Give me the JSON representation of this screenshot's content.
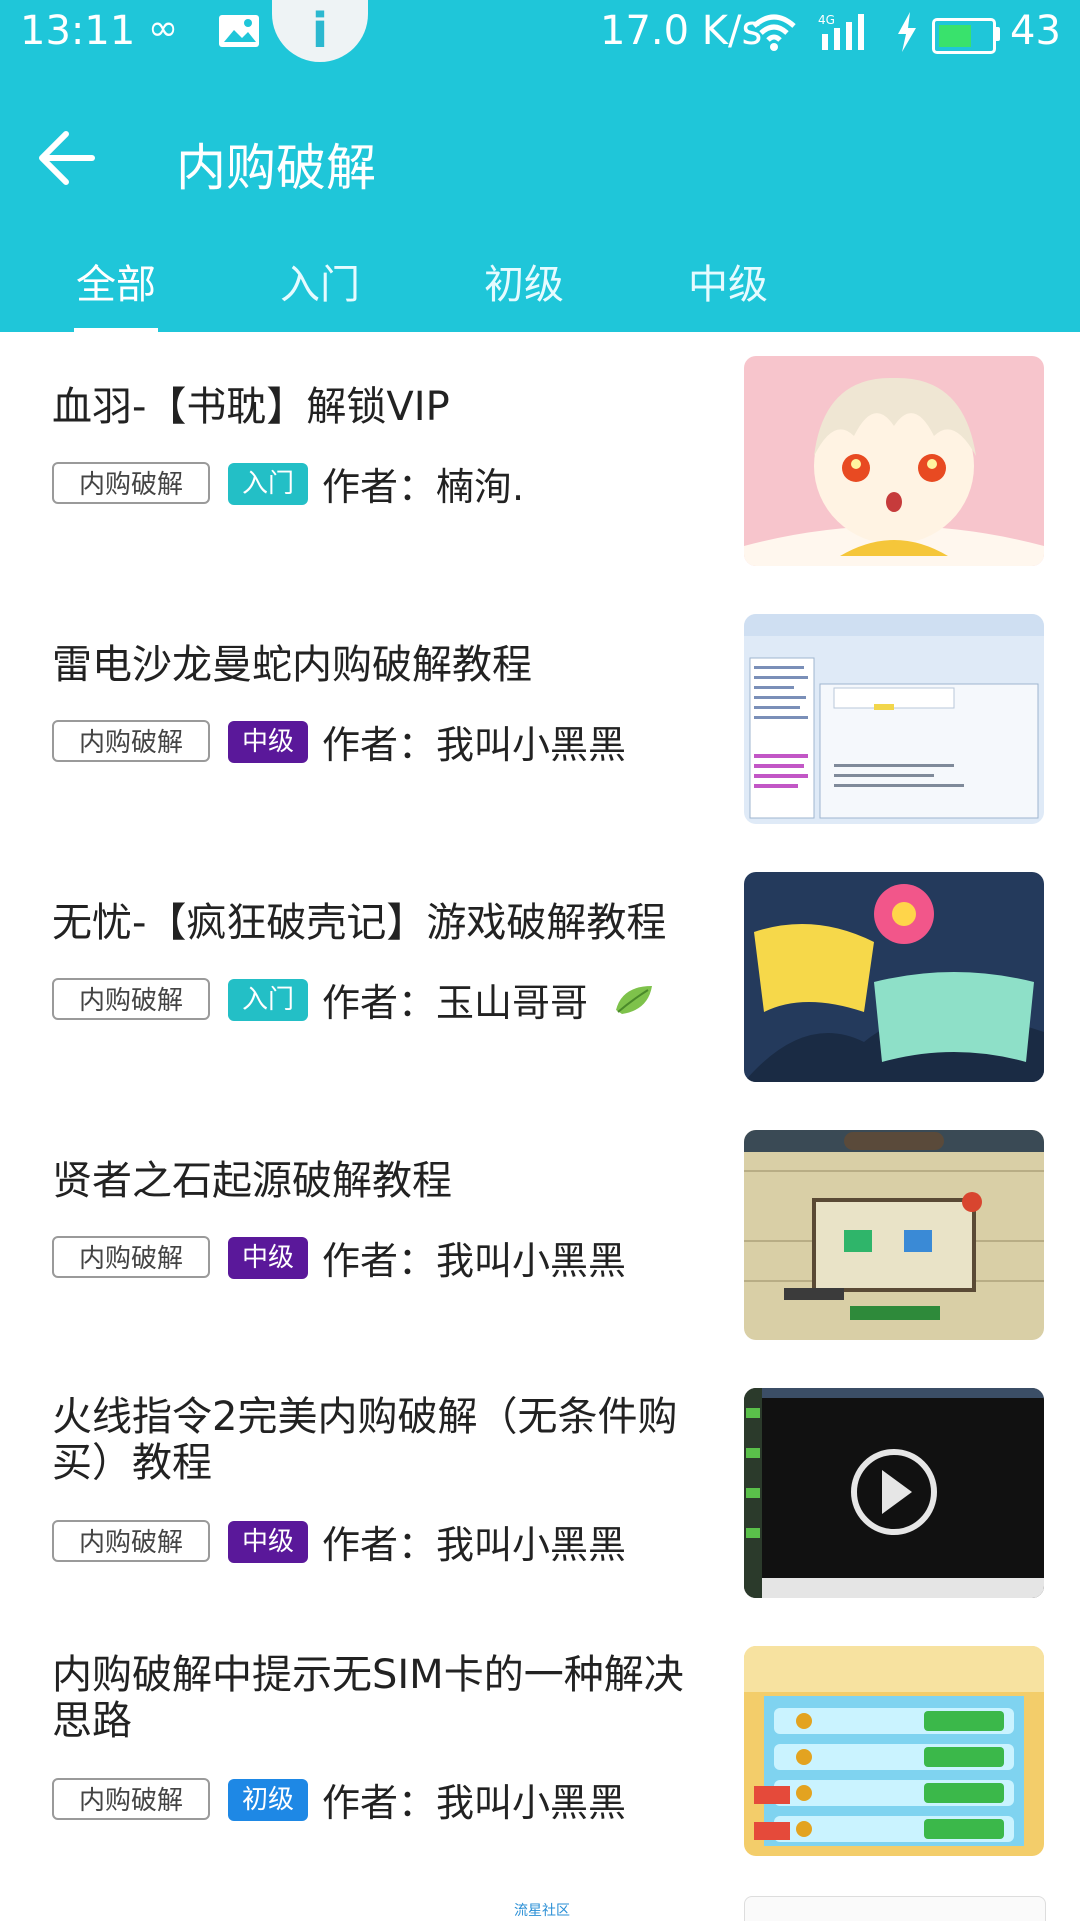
{
  "status_bar": {
    "time": "13:11",
    "speed": "17.0 K/s",
    "battery_level": "43",
    "battery_fraction": 0.43,
    "icons": [
      "infinity-icon",
      "image-icon",
      "info-icon",
      "wifi-icon",
      "signal-4g-icon",
      "charging-icon",
      "battery-icon"
    ]
  },
  "header": {
    "title": "内购破解",
    "back_icon": "arrow-left-icon",
    "background": "#1fc6d9"
  },
  "tabs": [
    {
      "label": "全部",
      "active": true
    },
    {
      "label": "入门",
      "active": false
    },
    {
      "label": "初级",
      "active": false
    },
    {
      "label": "中级",
      "active": false
    }
  ],
  "level_colors": {
    "入门": "#23bfc6",
    "中级": "#5a189a",
    "初级": "#1e88e5"
  },
  "items": [
    {
      "title": "血羽-【书耽】解锁VIP",
      "category": "内购破解",
      "level": "入门",
      "author": "作者：楠洵.",
      "thumb": "anime-character-thumbnail"
    },
    {
      "title": "雷电沙龙曼蛇内购破解教程",
      "category": "内购破解",
      "level": "中级",
      "author": "作者：我叫小黑黑",
      "thumb": "software-window-thumbnail"
    },
    {
      "title": "无忧-【疯狂破壳记】游戏破解教程",
      "category": "内购破解",
      "level": "入门",
      "author": "作者：玉山哥哥",
      "thumb": "game-logo-thumbnail"
    },
    {
      "title": "贤者之石起源破解教程",
      "category": "内购破解",
      "level": "中级",
      "author": "作者：我叫小黑黑",
      "thumb": "game-shop-thumbnail"
    },
    {
      "title": "火线指令2完美内购破解（无条件购买）教程",
      "category": "内购破解",
      "level": "中级",
      "author": "作者：我叫小黑黑",
      "thumb": "video-thumbnail"
    },
    {
      "title": "内购破解中提示无SIM卡的一种解决思路",
      "category": "内购破解",
      "level": "初级",
      "author": "作者：我叫小黑黑",
      "thumb": "game-store-thumbnail"
    }
  ],
  "footer": {
    "label": "流星社区"
  }
}
